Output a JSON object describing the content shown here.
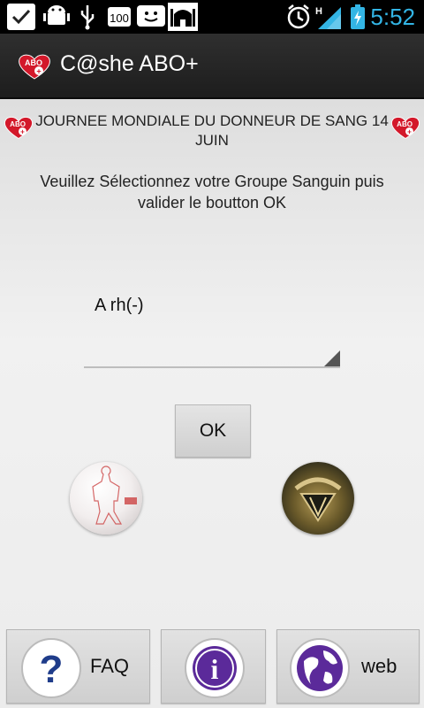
{
  "status_bar": {
    "time": "5:52",
    "battery_level_text": "100",
    "network_type": "H",
    "icons": [
      "checkmark-icon",
      "android-debug-icon",
      "usb-icon",
      "battery-100-icon",
      "messenger-icon",
      "mosque-icon",
      "alarm-icon",
      "signal-icon",
      "battery-charging-icon"
    ]
  },
  "app": {
    "title": "C@she ABO+",
    "logo_text": "ABO",
    "logo_plus": "+"
  },
  "banner": {
    "text": "JOURNEE MONDIALE DU DONNEUR DE SANG 14 JUIN",
    "heart_text": "ABO",
    "heart_plus": "+"
  },
  "instruction": "Veuillez Sélectionnez votre Groupe Sanguin puis valider le boutton OK",
  "blood_group_spinner": {
    "selected": "A rh(-)"
  },
  "ok_button": {
    "label": "OK"
  },
  "image_buttons": [
    "body-figure-icon",
    "emblem-icon"
  ],
  "bottom_bar": {
    "faq": {
      "label": "FAQ",
      "icon_text": "?"
    },
    "info": {
      "icon_text": "i"
    },
    "web": {
      "label": "web"
    }
  },
  "colors": {
    "status_accent": "#33b5e5",
    "blood_red": "#d3182a",
    "icon_purple": "#5b2a9a"
  }
}
